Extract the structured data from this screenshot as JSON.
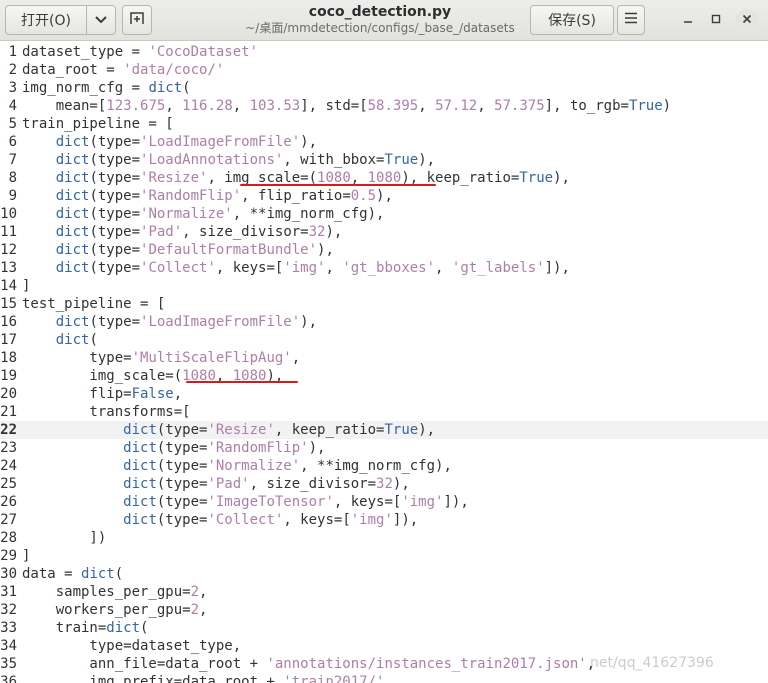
{
  "header": {
    "open_label": "打开(O)",
    "save_label": "保存(S)",
    "title": "coco_detection.py",
    "subtitle": "~/桌面/mmdetection/configs/_base_/datasets"
  },
  "icons": {
    "open_dropdown": "chevron-down-icon",
    "new_tab": "new-tab-icon",
    "menu": "hamburger-menu-icon",
    "minimize": "minimize-icon",
    "maximize": "maximize-icon",
    "close": "close-icon"
  },
  "colors": {
    "string": "#ad7fa8",
    "number": "#ad7fa8",
    "builtin": "#3465a4",
    "annotation": "#d91a1a"
  },
  "editor": {
    "current_line": 22,
    "lines": [
      {
        "num": "1",
        "tokens": [
          [
            "p",
            "dataset_type = "
          ],
          [
            "s",
            "'CocoDataset'"
          ]
        ]
      },
      {
        "num": "2",
        "tokens": [
          [
            "p",
            "data_root = "
          ],
          [
            "s",
            "'data/coco/'"
          ]
        ]
      },
      {
        "num": "3",
        "tokens": [
          [
            "p",
            "img_norm_cfg = "
          ],
          [
            "b",
            "dict"
          ],
          [
            "p",
            "("
          ]
        ]
      },
      {
        "num": "4",
        "tokens": [
          [
            "p",
            "    mean=["
          ],
          [
            "n",
            "123.675"
          ],
          [
            "p",
            ", "
          ],
          [
            "n",
            "116.28"
          ],
          [
            "p",
            ", "
          ],
          [
            "n",
            "103.53"
          ],
          [
            "p",
            "], std=["
          ],
          [
            "n",
            "58.395"
          ],
          [
            "p",
            ", "
          ],
          [
            "n",
            "57.12"
          ],
          [
            "p",
            ", "
          ],
          [
            "n",
            "57.375"
          ],
          [
            "p",
            "], to_rgb="
          ],
          [
            "k",
            "True"
          ],
          [
            "p",
            ")"
          ]
        ]
      },
      {
        "num": "5",
        "tokens": [
          [
            "p",
            "train_pipeline = ["
          ]
        ]
      },
      {
        "num": "6",
        "tokens": [
          [
            "p",
            "    "
          ],
          [
            "b",
            "dict"
          ],
          [
            "p",
            "(type="
          ],
          [
            "s",
            "'LoadImageFromFile'"
          ],
          [
            "p",
            "),"
          ]
        ]
      },
      {
        "num": "7",
        "tokens": [
          [
            "p",
            "    "
          ],
          [
            "b",
            "dict"
          ],
          [
            "p",
            "(type="
          ],
          [
            "s",
            "'LoadAnnotations'"
          ],
          [
            "p",
            ", with_bbox="
          ],
          [
            "k",
            "True"
          ],
          [
            "p",
            "),"
          ]
        ]
      },
      {
        "num": "8",
        "tokens": [
          [
            "p",
            "    "
          ],
          [
            "b",
            "dict"
          ],
          [
            "p",
            "(type="
          ],
          [
            "s",
            "'Resize'"
          ],
          [
            "p",
            ", img_scale=("
          ],
          [
            "n",
            "1080"
          ],
          [
            "p",
            ", "
          ],
          [
            "n",
            "1080"
          ],
          [
            "p",
            "), keep_ratio="
          ],
          [
            "k",
            "True"
          ],
          [
            "p",
            "),"
          ]
        ]
      },
      {
        "num": "9",
        "tokens": [
          [
            "p",
            "    "
          ],
          [
            "b",
            "dict"
          ],
          [
            "p",
            "(type="
          ],
          [
            "s",
            "'RandomFlip'"
          ],
          [
            "p",
            ", flip_ratio="
          ],
          [
            "n",
            "0.5"
          ],
          [
            "p",
            "),"
          ]
        ]
      },
      {
        "num": "10",
        "tokens": [
          [
            "p",
            "    "
          ],
          [
            "b",
            "dict"
          ],
          [
            "p",
            "(type="
          ],
          [
            "s",
            "'Normalize'"
          ],
          [
            "p",
            ", **img_norm_cfg),"
          ]
        ]
      },
      {
        "num": "11",
        "tokens": [
          [
            "p",
            "    "
          ],
          [
            "b",
            "dict"
          ],
          [
            "p",
            "(type="
          ],
          [
            "s",
            "'Pad'"
          ],
          [
            "p",
            ", size_divisor="
          ],
          [
            "n",
            "32"
          ],
          [
            "p",
            "),"
          ]
        ]
      },
      {
        "num": "12",
        "tokens": [
          [
            "p",
            "    "
          ],
          [
            "b",
            "dict"
          ],
          [
            "p",
            "(type="
          ],
          [
            "s",
            "'DefaultFormatBundle'"
          ],
          [
            "p",
            "),"
          ]
        ]
      },
      {
        "num": "13",
        "tokens": [
          [
            "p",
            "    "
          ],
          [
            "b",
            "dict"
          ],
          [
            "p",
            "(type="
          ],
          [
            "s",
            "'Collect'"
          ],
          [
            "p",
            ", keys=["
          ],
          [
            "s",
            "'img'"
          ],
          [
            "p",
            ", "
          ],
          [
            "s",
            "'gt_bboxes'"
          ],
          [
            "p",
            ", "
          ],
          [
            "s",
            "'gt_labels'"
          ],
          [
            "p",
            "]),"
          ]
        ]
      },
      {
        "num": "14",
        "tokens": [
          [
            "p",
            "]"
          ]
        ]
      },
      {
        "num": "15",
        "tokens": [
          [
            "p",
            "test_pipeline = ["
          ]
        ]
      },
      {
        "num": "16",
        "tokens": [
          [
            "p",
            "    "
          ],
          [
            "b",
            "dict"
          ],
          [
            "p",
            "(type="
          ],
          [
            "s",
            "'LoadImageFromFile'"
          ],
          [
            "p",
            "),"
          ]
        ]
      },
      {
        "num": "17",
        "tokens": [
          [
            "p",
            "    "
          ],
          [
            "b",
            "dict"
          ],
          [
            "p",
            "("
          ]
        ]
      },
      {
        "num": "18",
        "tokens": [
          [
            "p",
            "        type="
          ],
          [
            "s",
            "'MultiScaleFlipAug'"
          ],
          [
            "p",
            ","
          ]
        ]
      },
      {
        "num": "19",
        "tokens": [
          [
            "p",
            "        img_scale=("
          ],
          [
            "n",
            "1080"
          ],
          [
            "p",
            ", "
          ],
          [
            "n",
            "1080"
          ],
          [
            "p",
            "),"
          ]
        ]
      },
      {
        "num": "20",
        "tokens": [
          [
            "p",
            "        flip="
          ],
          [
            "k",
            "False"
          ],
          [
            "p",
            ","
          ]
        ]
      },
      {
        "num": "21",
        "tokens": [
          [
            "p",
            "        transforms=["
          ]
        ]
      },
      {
        "num": "22",
        "tokens": [
          [
            "p",
            "            "
          ],
          [
            "b",
            "dict"
          ],
          [
            "p",
            "(type="
          ],
          [
            "s",
            "'Resize'"
          ],
          [
            "p",
            ", keep_ratio="
          ],
          [
            "k",
            "True"
          ],
          [
            "p",
            "),"
          ]
        ]
      },
      {
        "num": "23",
        "tokens": [
          [
            "p",
            "            "
          ],
          [
            "b",
            "dict"
          ],
          [
            "p",
            "(type="
          ],
          [
            "s",
            "'RandomFlip'"
          ],
          [
            "p",
            "),"
          ]
        ]
      },
      {
        "num": "24",
        "tokens": [
          [
            "p",
            "            "
          ],
          [
            "b",
            "dict"
          ],
          [
            "p",
            "(type="
          ],
          [
            "s",
            "'Normalize'"
          ],
          [
            "p",
            ", **img_norm_cfg),"
          ]
        ]
      },
      {
        "num": "25",
        "tokens": [
          [
            "p",
            "            "
          ],
          [
            "b",
            "dict"
          ],
          [
            "p",
            "(type="
          ],
          [
            "s",
            "'Pad'"
          ],
          [
            "p",
            ", size_divisor="
          ],
          [
            "n",
            "32"
          ],
          [
            "p",
            "),"
          ]
        ]
      },
      {
        "num": "26",
        "tokens": [
          [
            "p",
            "            "
          ],
          [
            "b",
            "dict"
          ],
          [
            "p",
            "(type="
          ],
          [
            "s",
            "'ImageToTensor'"
          ],
          [
            "p",
            ", keys=["
          ],
          [
            "s",
            "'img'"
          ],
          [
            "p",
            "]),"
          ]
        ]
      },
      {
        "num": "27",
        "tokens": [
          [
            "p",
            "            "
          ],
          [
            "b",
            "dict"
          ],
          [
            "p",
            "(type="
          ],
          [
            "s",
            "'Collect'"
          ],
          [
            "p",
            ", keys=["
          ],
          [
            "s",
            "'img'"
          ],
          [
            "p",
            "]),"
          ]
        ]
      },
      {
        "num": "28",
        "tokens": [
          [
            "p",
            "        ])"
          ]
        ]
      },
      {
        "num": "29",
        "tokens": [
          [
            "p",
            "]"
          ]
        ]
      },
      {
        "num": "30",
        "tokens": [
          [
            "p",
            "data = "
          ],
          [
            "b",
            "dict"
          ],
          [
            "p",
            "("
          ]
        ]
      },
      {
        "num": "31",
        "tokens": [
          [
            "p",
            "    samples_per_gpu="
          ],
          [
            "n",
            "2"
          ],
          [
            "p",
            ","
          ]
        ]
      },
      {
        "num": "32",
        "tokens": [
          [
            "p",
            "    workers_per_gpu="
          ],
          [
            "n",
            "2"
          ],
          [
            "p",
            ","
          ]
        ]
      },
      {
        "num": "33",
        "tokens": [
          [
            "p",
            "    train="
          ],
          [
            "b",
            "dict"
          ],
          [
            "p",
            "("
          ]
        ]
      },
      {
        "num": "34",
        "tokens": [
          [
            "p",
            "        type=dataset_type,"
          ]
        ]
      },
      {
        "num": "35",
        "tokens": [
          [
            "p",
            "        ann_file=data_root + "
          ],
          [
            "s",
            "'annotations/instances_train2017.json'"
          ],
          [
            "p",
            ","
          ]
        ]
      },
      {
        "num": "36",
        "tokens": [
          [
            "p",
            "        img_prefix=data_root + "
          ],
          [
            "s",
            "'train2017/'"
          ],
          [
            "p",
            ","
          ]
        ]
      }
    ]
  },
  "watermark": "net/qq_41627396"
}
